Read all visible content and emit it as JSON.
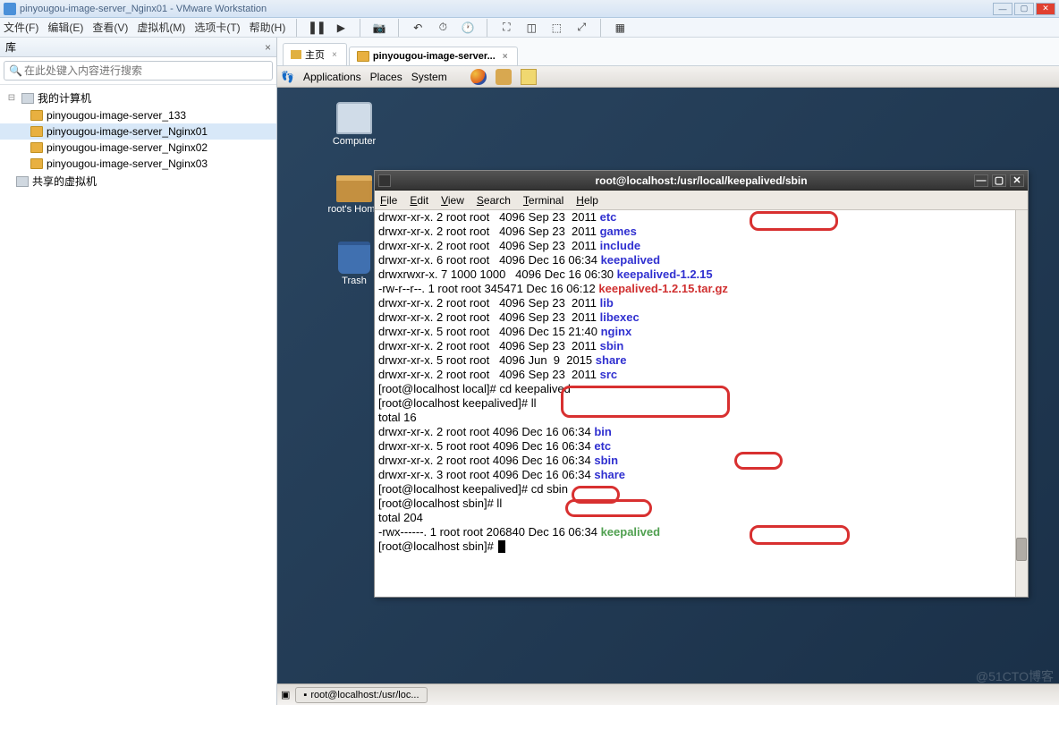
{
  "window_title": "pinyougou-image-server_Nginx01 - VMware Workstation",
  "menubar": {
    "file": "文件(F)",
    "edit": "编辑(E)",
    "view": "查看(V)",
    "vm": "虚拟机(M)",
    "tabs": "选项卡(T)",
    "help": "帮助(H)"
  },
  "sidebar": {
    "title": "库",
    "search_placeholder": "在此处键入内容进行搜索",
    "root": "我的计算机",
    "vms": [
      "pinyougou-image-server_133",
      "pinyougou-image-server_Nginx01",
      "pinyougou-image-server_Nginx02",
      "pinyougou-image-server_Nginx03"
    ],
    "shared": "共享的虚拟机"
  },
  "tabs": {
    "home": "主页",
    "active": "pinyougou-image-server..."
  },
  "gnome": {
    "apps": "Applications",
    "places": "Places",
    "system": "System"
  },
  "desktop_icons": {
    "computer": "Computer",
    "home": "root's Home",
    "trash": "Trash"
  },
  "terminal": {
    "title": "root@localhost:/usr/local/keepalived/sbin",
    "menu": {
      "file": "File",
      "edit": "Edit",
      "view": "View",
      "search": "Search",
      "terminal": "Terminal",
      "help": "Help"
    },
    "lines": [
      {
        "perm": "drwxr-xr-x. 2 root root   4096 Sep 23  2011 ",
        "name": "etc",
        "cls": "blue"
      },
      {
        "perm": "drwxr-xr-x. 2 root root   4096 Sep 23  2011 ",
        "name": "games",
        "cls": "blue"
      },
      {
        "perm": "drwxr-xr-x. 2 root root   4096 Sep 23  2011 ",
        "name": "include",
        "cls": "blue"
      },
      {
        "perm": "drwxr-xr-x. 6 root root   4096 Dec 16 06:34 ",
        "name": "keepalived",
        "cls": "blue"
      },
      {
        "perm": "drwxrwxr-x. 7 1000 1000   4096 Dec 16 06:30 ",
        "name": "keepalived-1.2.15",
        "cls": "blue"
      },
      {
        "perm": "-rw-r--r--. 1 root root 345471 Dec 16 06:12 ",
        "name": "keepalived-1.2.15.tar.gz",
        "cls": "red"
      },
      {
        "perm": "drwxr-xr-x. 2 root root   4096 Sep 23  2011 ",
        "name": "lib",
        "cls": "blue"
      },
      {
        "perm": "drwxr-xr-x. 2 root root   4096 Sep 23  2011 ",
        "name": "libexec",
        "cls": "blue"
      },
      {
        "perm": "drwxr-xr-x. 5 root root   4096 Dec 15 21:40 ",
        "name": "nginx",
        "cls": "blue"
      },
      {
        "perm": "drwxr-xr-x. 2 root root   4096 Sep 23  2011 ",
        "name": "sbin",
        "cls": "blue"
      },
      {
        "perm": "drwxr-xr-x. 5 root root   4096 Jun  9  2015 ",
        "name": "share",
        "cls": "blue"
      },
      {
        "perm": "drwxr-xr-x. 2 root root   4096 Sep 23  2011 ",
        "name": "src",
        "cls": "blue"
      }
    ],
    "cmd1": "[root@localhost local]# cd keepalived",
    "cmd2": "[root@localhost keepalived]# ll",
    "total1": "total 16",
    "lines2": [
      {
        "perm": "drwxr-xr-x. 2 root root 4096 Dec 16 06:34 ",
        "name": "bin",
        "cls": "blue"
      },
      {
        "perm": "drwxr-xr-x. 5 root root 4096 Dec 16 06:34 ",
        "name": "etc",
        "cls": "blue"
      },
      {
        "perm": "drwxr-xr-x. 2 root root 4096 Dec 16 06:34 ",
        "name": "sbin",
        "cls": "blue"
      },
      {
        "perm": "drwxr-xr-x. 3 root root 4096 Dec 16 06:34 ",
        "name": "share",
        "cls": "blue"
      }
    ],
    "cmd3": "[root@localhost keepalived]# cd sbin",
    "cmd4": "[root@localhost sbin]# ll",
    "total2": "total 204",
    "lines3": [
      {
        "perm": "-rwx------. 1 root root 206840 Dec 16 06:34 ",
        "name": "keepalived",
        "cls": "green"
      }
    ],
    "prompt": "[root@localhost sbin]# "
  },
  "taskbar": {
    "item": "root@localhost:/usr/loc..."
  },
  "watermark": "@51CTO博客"
}
